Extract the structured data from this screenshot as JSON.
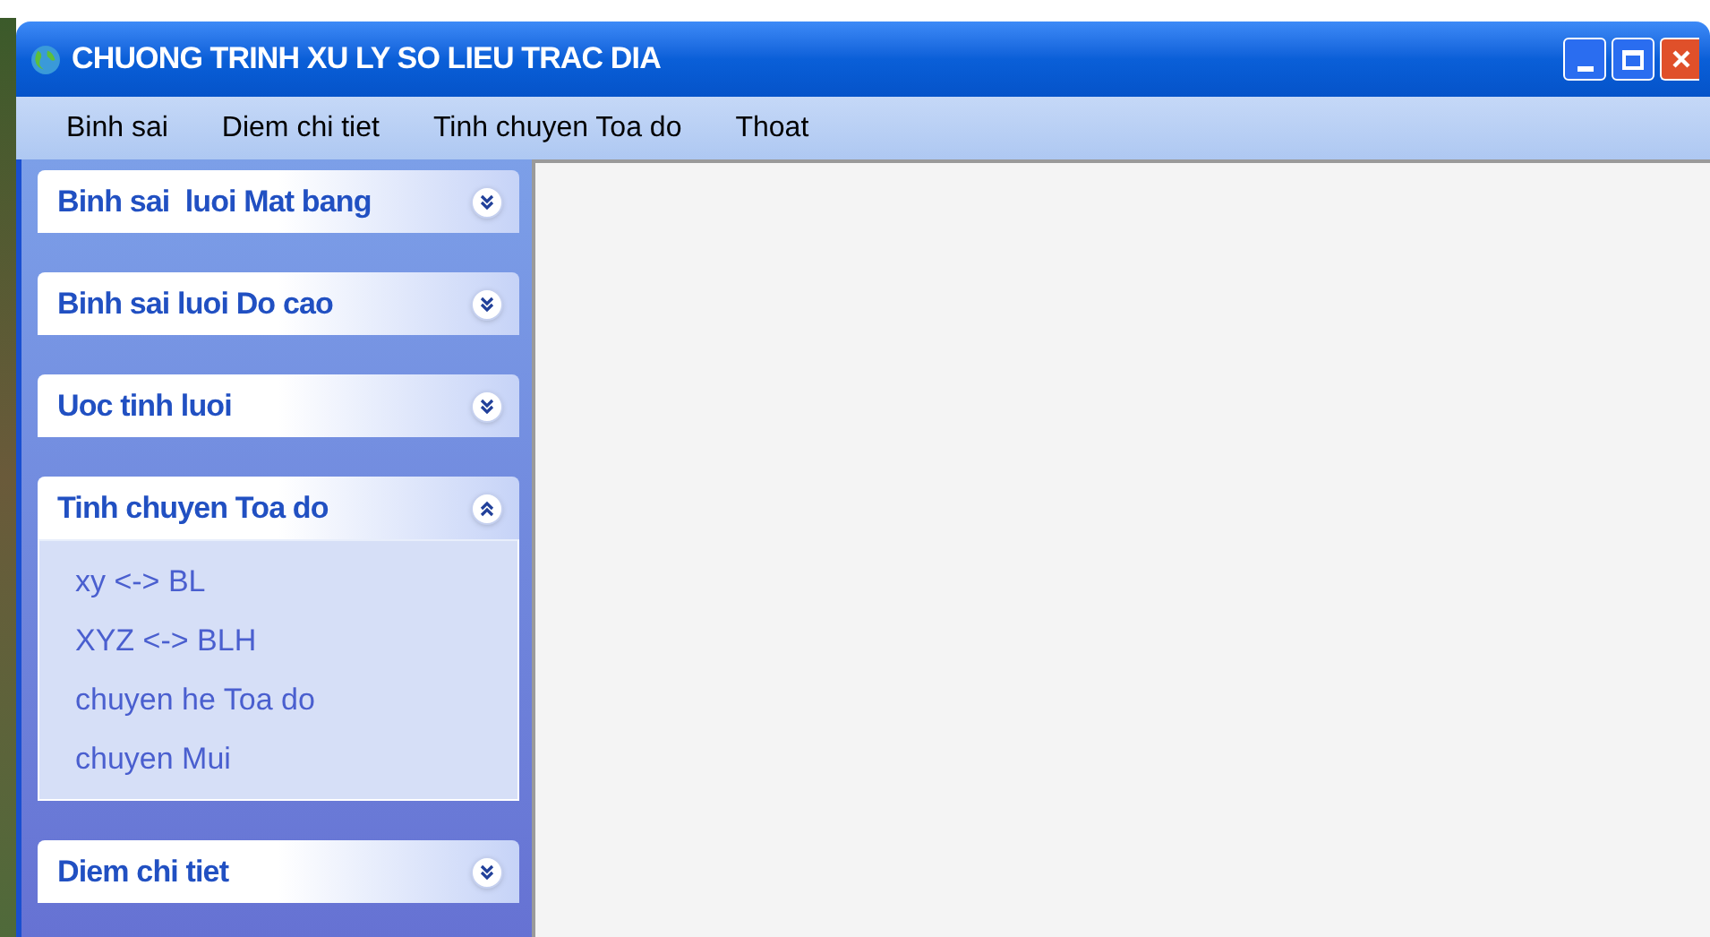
{
  "window": {
    "title": "CHUONG TRINH XU LY SO LIEU TRAC DIA"
  },
  "menu": [
    "Binh sai",
    "Diem chi tiet",
    "Tinh chuyen Toa do",
    "Thoat"
  ],
  "sidebar": {
    "groups": [
      {
        "title": "Binh sai  luoi Mat bang",
        "expanded": false
      },
      {
        "title": "Binh sai luoi Do cao",
        "expanded": false
      },
      {
        "title": "Uoc tinh luoi",
        "expanded": false
      },
      {
        "title": "Tinh chuyen Toa do",
        "expanded": true,
        "items": [
          "xy <-> BL",
          "XYZ <-> BLH",
          "chuyen he Toa do",
          "chuyen Mui"
        ]
      },
      {
        "title": "Diem chi tiet",
        "expanded": false
      }
    ]
  }
}
